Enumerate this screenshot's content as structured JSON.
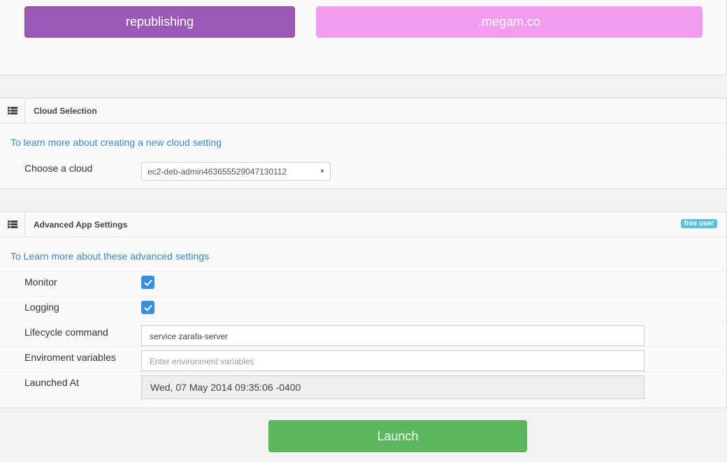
{
  "top": {
    "app_name": "republishing",
    "domain": ".megam.co"
  },
  "cloud_panel": {
    "title": "Cloud Selection",
    "icon": "list-icon",
    "learn_link": "To learn more about creating a new cloud setting",
    "choose_label": "Choose a cloud",
    "selected_cloud": "ec2-deb-admin463655529047130112"
  },
  "advanced_panel": {
    "title": "Advanced App Settings",
    "icon": "list-icon",
    "badge": "free user",
    "learn_link": "To Learn more about these advanced settings",
    "monitor_label": "Monitor",
    "monitor_checked": true,
    "logging_label": "Logging",
    "logging_checked": true,
    "lifecycle_label": "Lifecycle command",
    "lifecycle_value": "service zarafa-server",
    "env_label": "Enviroment variables",
    "env_placeholder": "Enter environment variables",
    "launched_label": "Launched At",
    "launched_value": "Wed, 07 May 2014 09:35:06 -0400"
  },
  "actions": {
    "launch_label": "Launch"
  },
  "colors": {
    "app_button": "#9b59b6",
    "domain_button": "#f09cf0",
    "link": "#3a87c8",
    "badge": "#5bc0de",
    "checkbox": "#3a8ede",
    "launch": "#5cb85c"
  }
}
